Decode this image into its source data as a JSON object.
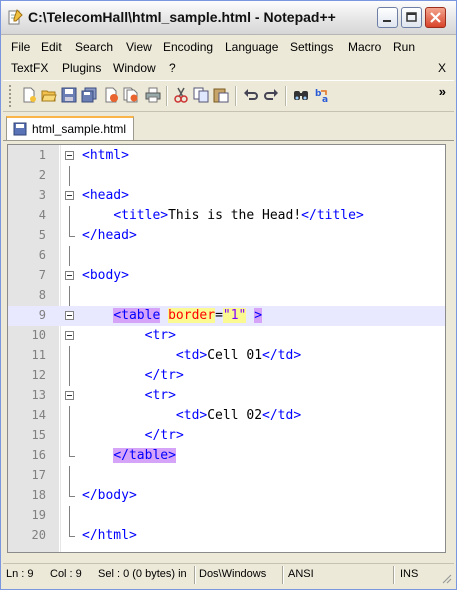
{
  "window": {
    "title": "C:\\TelecomHall\\html_sample.html - Notepad++"
  },
  "menu": {
    "row1": [
      "File",
      "Edit",
      "Search",
      "View",
      "Encoding",
      "Language",
      "Settings",
      "Macro",
      "Run"
    ],
    "row2": [
      "TextFX",
      "Plugins",
      "Window",
      "?"
    ],
    "close_doc": "X"
  },
  "toolbar": {
    "icons": [
      "new-file-icon",
      "open-file-icon",
      "save-icon",
      "save-all-icon",
      "close-icon",
      "close-all-icon",
      "print-icon",
      "cut-icon",
      "copy-icon",
      "paste-icon",
      "undo-icon",
      "redo-icon",
      "find-icon",
      "replace-icon"
    ],
    "more": "»"
  },
  "tabs": [
    {
      "label": "html_sample.html"
    }
  ],
  "editor": {
    "highlight_line": 9,
    "lines": [
      {
        "n": "1",
        "text": "<html>"
      },
      {
        "n": "2",
        "text": ""
      },
      {
        "n": "3",
        "text": "<head>"
      },
      {
        "n": "4",
        "text": "    <title>This is the Head!</title>"
      },
      {
        "n": "5",
        "text": "</head>"
      },
      {
        "n": "6",
        "text": ""
      },
      {
        "n": "7",
        "text": "<body>"
      },
      {
        "n": "8",
        "text": ""
      },
      {
        "n": "9",
        "text": "    <table border=\"1\" >"
      },
      {
        "n": "10",
        "text": "        <tr>"
      },
      {
        "n": "11",
        "text": "            <td>Cell 01</td>"
      },
      {
        "n": "12",
        "text": "        </tr>"
      },
      {
        "n": "13",
        "text": "        <tr>"
      },
      {
        "n": "14",
        "text": "            <td>Cell 02</td>"
      },
      {
        "n": "15",
        "text": "        </tr>"
      },
      {
        "n": "16",
        "text": "    </table>"
      },
      {
        "n": "17",
        "text": ""
      },
      {
        "n": "18",
        "text": "</body>"
      },
      {
        "n": "19",
        "text": ""
      },
      {
        "n": "20",
        "text": "</html>"
      }
    ]
  },
  "status": {
    "ln": "Ln : 9",
    "col": "Col : 9",
    "sel": "Sel : 0 (0 bytes) in",
    "eol": "Dos\\Windows",
    "encoding": "ANSI",
    "mode": "INS"
  }
}
